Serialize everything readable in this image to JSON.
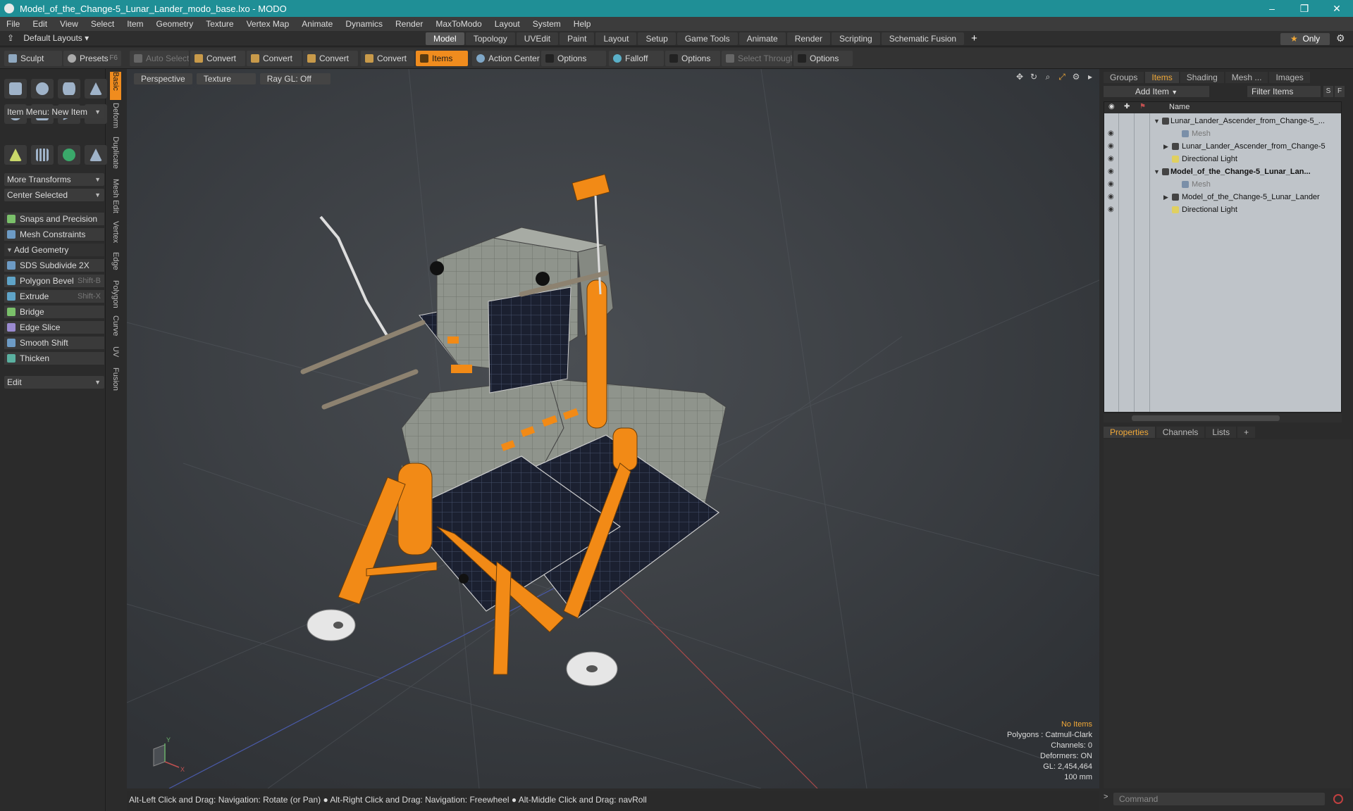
{
  "window": {
    "title": "Model_of_the_Change-5_Lunar_Lander_modo_base.lxo - MODO"
  },
  "menu": [
    "File",
    "Edit",
    "View",
    "Select",
    "Item",
    "Geometry",
    "Texture",
    "Vertex Map",
    "Animate",
    "Dynamics",
    "Render",
    "MaxToModo",
    "Layout",
    "System",
    "Help"
  ],
  "layouts": {
    "label": "Default Layouts",
    "only_label": "Only"
  },
  "tabs": [
    "Model",
    "Topology",
    "UVEdit",
    "Paint",
    "Layout",
    "Setup",
    "Game Tools",
    "Animate",
    "Render",
    "Scripting",
    "Schematic Fusion"
  ],
  "active_tab": "Model",
  "toolbar": {
    "sculpt": "Sculpt",
    "presets": "Presets",
    "presets_key": "F6",
    "auto_select": "Auto Select",
    "convert1": "Convert",
    "convert2": "Convert",
    "convert3": "Convert",
    "convert4": "Convert",
    "items": "Items",
    "action_center": "Action Center",
    "options1": "Options",
    "falloff": "Falloff",
    "options2": "Options",
    "select_through": "Select Through",
    "options3": "Options"
  },
  "left": {
    "item_menu": "Item Menu: New Item",
    "more_transforms": "More Transforms",
    "center_selected": "Center Selected",
    "snaps": "Snaps and Precision",
    "mesh_constraints": "Mesh Constraints",
    "add_geometry": "Add Geometry",
    "tools": [
      {
        "label": "SDS Subdivide 2X",
        "key": ""
      },
      {
        "label": "Polygon Bevel",
        "key": "Shift-B"
      },
      {
        "label": "Extrude",
        "key": "Shift-X"
      },
      {
        "label": "Bridge",
        "key": ""
      },
      {
        "label": "Edge Slice",
        "key": ""
      },
      {
        "label": "Smooth Shift",
        "key": ""
      },
      {
        "label": "Thicken",
        "key": ""
      }
    ],
    "edit": "Edit"
  },
  "side_tabs": [
    "Basic",
    "Deform",
    "Duplicate",
    "Mesh Edit",
    "Vertex",
    "Edge",
    "Polygon",
    "Curve",
    "UV",
    "Fusion"
  ],
  "viewport": {
    "perspective": "Perspective",
    "texture": "Texture",
    "raygl": "Ray GL: Off",
    "stats": {
      "no_items": "No Items",
      "polygons": "Polygons : Catmull-Clark",
      "channels": "Channels: 0",
      "deformers": "Deformers: ON",
      "gl": "GL: 2,454,464",
      "unit": "100 mm"
    }
  },
  "status": "Alt-Left Click and Drag: Navigation: Rotate (or Pan) ● Alt-Right Click and Drag: Navigation: Freewheel ● Alt-Middle Click and Drag: navRoll",
  "right": {
    "tabs": [
      "Groups",
      "Items",
      "Shading",
      "Mesh ...",
      "Images"
    ],
    "add_item": "Add Item",
    "filter": "Filter Items",
    "filter_s": "S",
    "filter_f": "F",
    "name_col": "Name",
    "tree": [
      {
        "label": "Lunar_Lander_Ascender_from_Change-5_...",
        "style": ""
      },
      {
        "label": "Mesh",
        "style": "grey"
      },
      {
        "label": "Lunar_Lander_Ascender_from_Change-5",
        "style": ""
      },
      {
        "label": "Directional Light",
        "style": ""
      },
      {
        "label": "Model_of_the_Change-5_Lunar_Lan...",
        "style": "bold"
      },
      {
        "label": "Mesh",
        "style": "grey"
      },
      {
        "label": "Model_of_the_Change-5_Lunar_Lander",
        "style": ""
      },
      {
        "label": "Directional Light",
        "style": ""
      }
    ],
    "prop_tabs": [
      "Properties",
      "Channels",
      "Lists"
    ],
    "command": "Command"
  },
  "colors": {
    "accent": "#f08c1e",
    "title_bar": "#1f8f96",
    "lander_orange": "#f28a16",
    "panel_dark": "#1b2030"
  }
}
